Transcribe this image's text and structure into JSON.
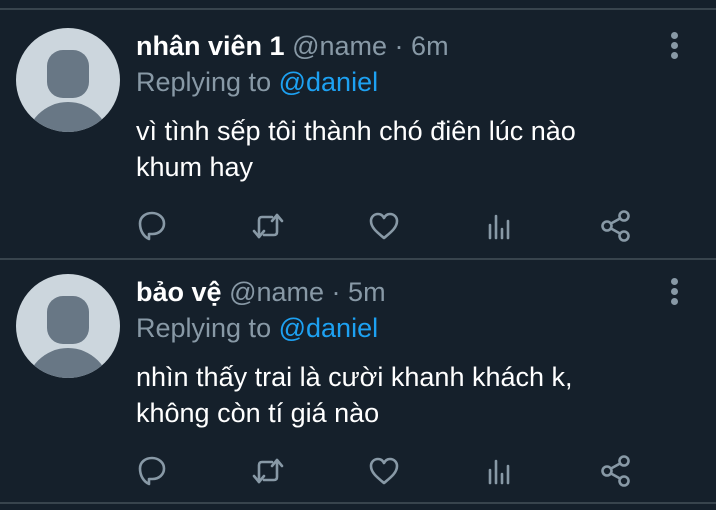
{
  "tweets": [
    {
      "display_name": "nhân viên 1",
      "handle": "@name",
      "separator": "·",
      "time": "6m",
      "replying_prefix": "Replying to",
      "replying_to": "@daniel",
      "text_line1": "vì tình sếp tôi thành chó điên lúc nào",
      "text_line2": "khum hay"
    },
    {
      "display_name": "bảo vệ",
      "handle": "@name",
      "separator": "·",
      "time": "5m",
      "replying_prefix": "Replying to",
      "replying_to": "@daniel",
      "text_line1": "nhìn thấy trai là cười khanh khách k,",
      "text_line2": "không còn tí giá nào"
    }
  ],
  "icons": [
    "reply-icon",
    "retweet-icon",
    "like-icon",
    "analytics-icon",
    "share-icon",
    "more-icon"
  ],
  "colors": {
    "background": "#15202b",
    "secondary_text": "#8899a6",
    "link": "#1da1f2",
    "divider": "#38444d"
  }
}
